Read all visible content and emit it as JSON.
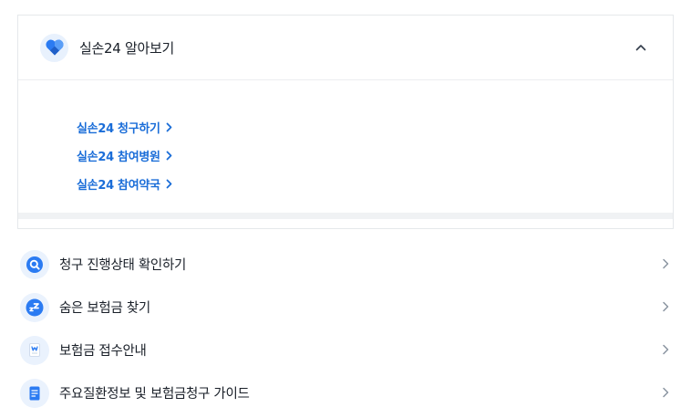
{
  "accordion": {
    "title": "실손24 알아보기",
    "icon": "heart-icon",
    "expanded": true,
    "links": [
      {
        "label": "실손24 청구하기"
      },
      {
        "label": "실손24 참여병원"
      },
      {
        "label": "실손24 참여약국"
      }
    ]
  },
  "menu": [
    {
      "label": "청구 진행상태 확인하기",
      "icon": "search-icon"
    },
    {
      "label": "숨은 보험금 찾기",
      "icon": "zzz-icon"
    },
    {
      "label": "보험금 접수안내",
      "icon": "won-receipt-icon"
    },
    {
      "label": "주요질환정보 및 보험금청구 가이드",
      "icon": "document-icon"
    }
  ],
  "colors": {
    "accent": "#1a6dd8",
    "icon_blue": "#2b7bf2",
    "icon_bg": "#eaf2fd",
    "text": "#191f28",
    "chevron": "#8b95a1"
  }
}
